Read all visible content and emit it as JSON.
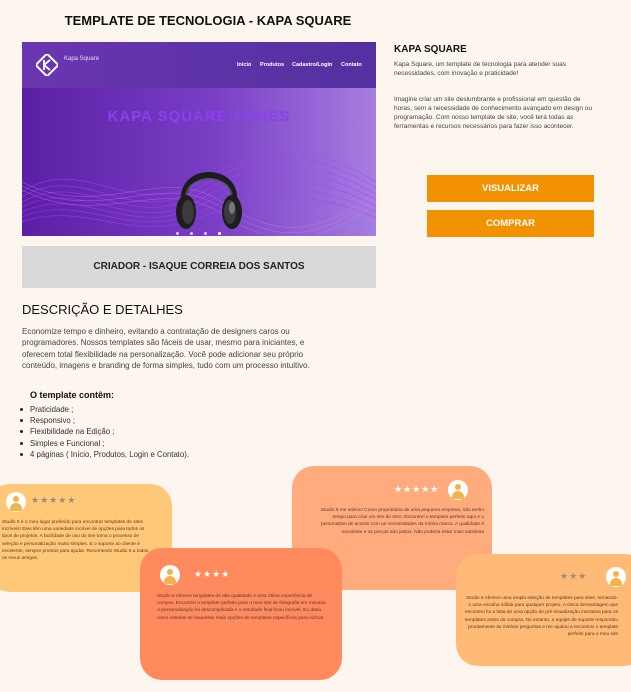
{
  "page": {
    "title": "TEMPLATE DE TECNOLOGIA - KAPA SQUARE"
  },
  "preview": {
    "brand_name": "Kapa Square",
    "nav": [
      "Início",
      "Produtos",
      "Cadastro/Login",
      "Contato"
    ],
    "hero": "KAPA SQUARE-FONES",
    "slides_total": 4,
    "active_slide": 4
  },
  "creator": {
    "label": "CRIADOR - ISAQUE CORREIA DOS SANTOS"
  },
  "product": {
    "name": "KAPA SQUARE",
    "tagline": "Kapa Square, um template de tecnologia para atender suas necessidades, com inovação e praticidade!",
    "description": "Imagine criar um site deslumbrante e profissional em questão de horas, sem a necessidade de conhecimento avançado em design ou programação. Com nosso template de site, você terá todas as ferramentas e recursos necessários para fazer isso acontecer."
  },
  "actions": {
    "view": "VISUALIZAR",
    "buy": "COMPRAR"
  },
  "details": {
    "heading": "DESCRIÇÃO E DETALHES",
    "text": "Economize tempo e dinheiro, evitando a contratação de designers caros ou programadores. Nossos templates são fáceis de usar, mesmo para iniciantes, e oferecem total flexibilidade na personalização. Você pode adicionar seu próprio conteúdo, imagens e branding de forma simples, tudo com um processo intuitivo.",
    "contents_heading": "O template contêm:",
    "contents": [
      "Praticidade ;",
      "Responsivo ;",
      "Flexibilidade na Edição ;",
      "Simples e Funcional ;",
      "4 páginas ( Início, Produtos, Login e Contato)."
    ]
  },
  "reviews": [
    {
      "stars": "★★★★★",
      "text": "Studio 5 é o meu lugar preferido para encontrar templates de sites incríveis! Eles têm uma variedade incrível de opções para todos os tipos de projetos. A facilidade de uso do site torna o processo de seleção e personalização muito simples. E o suporte ao cliente é excelente, sempre prontos para ajudar. Recomendo Studio 5 a todos os meus amigos."
    },
    {
      "stars": "★★★★★",
      "text": "Studio 5 me salvou! Como proprietária de uma pequena empresa, não tenho tempo para criar um site do zero. Encontrei o template perfeito aqui e o personalizei de acordo com as necessidades da minha marca. A qualidade é excelente e os preços são justos. Não poderia estar mais satisfeita"
    },
    {
      "stars": "★★★★",
      "text": "Studio 5 oferece templates de alta qualidade e uma ótima experiência de compra. Encontrei o template perfeito para o meu site de fotografia em minutos. A personalização foi descomplicada e o resultado final ficou incrível. Eu daria cinco estrelas se houvesse mais opções de templates específicos para nichos."
    },
    {
      "stars": "★★★",
      "text": "Studio 5 oferece uma ampla seleção de templates para sites, tornando-o uma escolha sólida para qualquer projeto. A única desvantagem que encontrei foi a falta de uma opção de pré-visualização interativa para os templates antes da compra. No entanto, a equipe de suporte respondeu prontamente às minhas perguntas e me ajudou a encontrar o template perfeito para o meu site"
    }
  ],
  "colors": {
    "accent": "#f39200",
    "card1": "#ffc778",
    "card2": "#ffab7e",
    "card3": "#ff8a5d",
    "card4": "#ffba76"
  }
}
